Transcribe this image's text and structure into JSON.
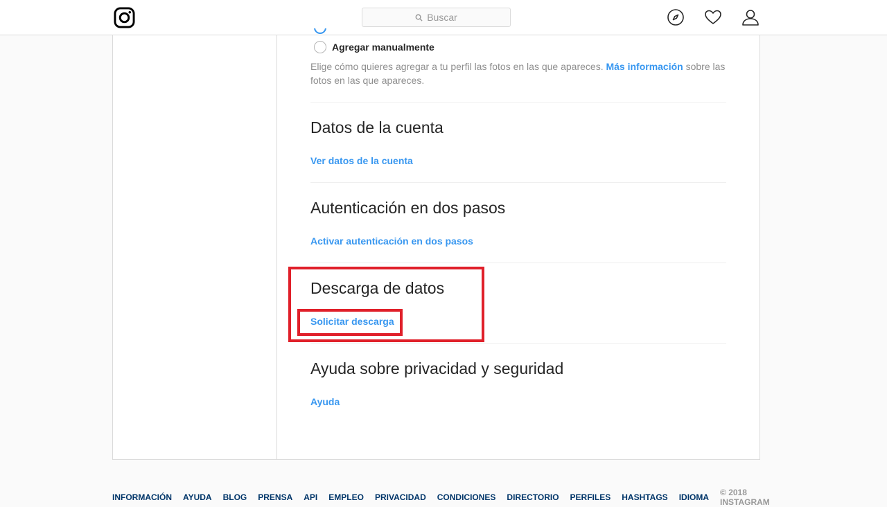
{
  "header": {
    "logo_icon": "instagram-logo-icon",
    "search_placeholder": "Buscar",
    "search_icon": "search-icon",
    "nav_icons": [
      "compass-icon",
      "heart-icon",
      "user-icon"
    ]
  },
  "photos_of_you": {
    "option_manual": "Agregar manualmente",
    "note_before": "Elige cómo quieres agregar a tu perfil las fotos en las que apareces. ",
    "note_link": "Más información",
    "note_after": " sobre las fotos en las que apareces."
  },
  "sections": [
    {
      "title": "Datos de la cuenta",
      "link": "Ver datos de la cuenta"
    },
    {
      "title": "Autenticación en dos pasos",
      "link": "Activar autenticación en dos pasos"
    },
    {
      "title": "Descarga de datos",
      "link": "Solicitar descarga"
    },
    {
      "title": "Ayuda sobre privacidad y seguridad",
      "link": "Ayuda"
    }
  ],
  "highlight_color": "#e0202a",
  "footer": {
    "links": [
      "INFORMACIÓN",
      "AYUDA",
      "BLOG",
      "PRENSA",
      "API",
      "EMPLEO",
      "PRIVACIDAD",
      "CONDICIONES",
      "DIRECTORIO",
      "PERFILES",
      "HASHTAGS",
      "IDIOMA"
    ],
    "copyright": "© 2018 INSTAGRAM"
  }
}
